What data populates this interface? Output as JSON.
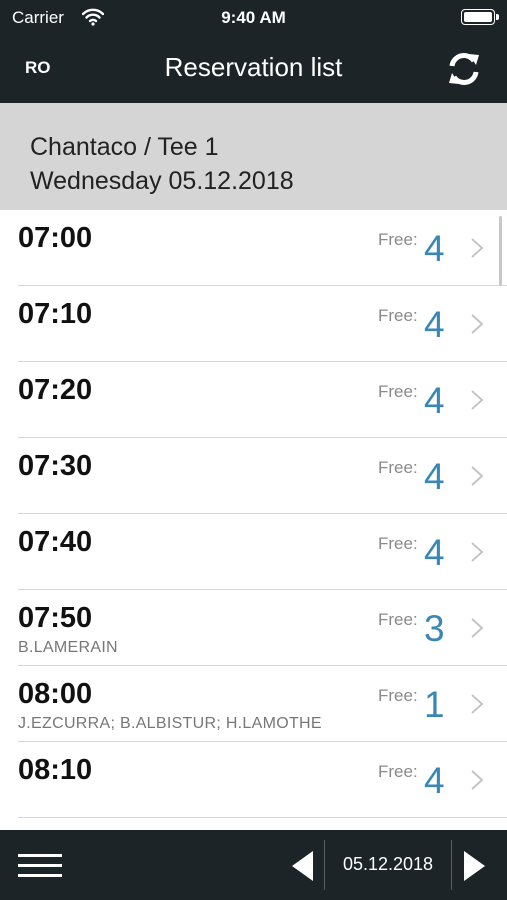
{
  "status_bar": {
    "carrier": "Carrier",
    "time": "9:40 AM"
  },
  "nav": {
    "left_label": "RO",
    "title": "Reservation list",
    "refresh_icon": "refresh-icon"
  },
  "header": {
    "course": "Chantaco / Tee 1",
    "date_line": "Wednesday 05.12.2018"
  },
  "free_label": "Free:",
  "slots": [
    {
      "time": "07:00",
      "free": "4",
      "players": ""
    },
    {
      "time": "07:10",
      "free": "4",
      "players": ""
    },
    {
      "time": "07:20",
      "free": "4",
      "players": ""
    },
    {
      "time": "07:30",
      "free": "4",
      "players": ""
    },
    {
      "time": "07:40",
      "free": "4",
      "players": ""
    },
    {
      "time": "07:50",
      "free": "3",
      "players": "B.LAMERAIN"
    },
    {
      "time": "08:00",
      "free": "1",
      "players": "J.EZCURRA; B.ALBISTUR; H.LAMOTHE"
    },
    {
      "time": "08:10",
      "free": "4",
      "players": ""
    }
  ],
  "toolbar": {
    "date": "05.12.2018",
    "menu_icon": "hamburger-menu-icon",
    "prev_icon": "triangle-left-icon",
    "next_icon": "triangle-right-icon"
  },
  "colors": {
    "bar_background": "#1c2428",
    "header_background": "#d5d5d5",
    "free_count": "#3a87b5"
  }
}
